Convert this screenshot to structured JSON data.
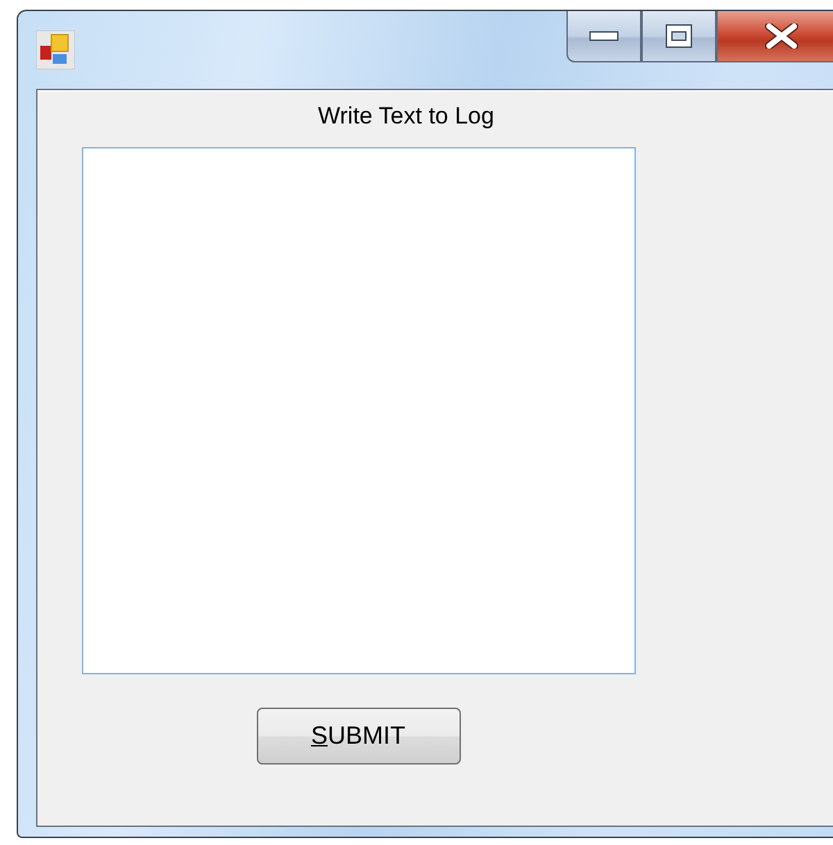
{
  "window": {
    "caption_buttons": [
      {
        "kind": "minimize"
      },
      {
        "kind": "maximize"
      },
      {
        "kind": "close"
      }
    ]
  },
  "label": "Write Text to Log",
  "log_text": {
    "focused": true
  },
  "button": {
    "label": "SUBMIT",
    "access_key_underlined": true
  }
}
